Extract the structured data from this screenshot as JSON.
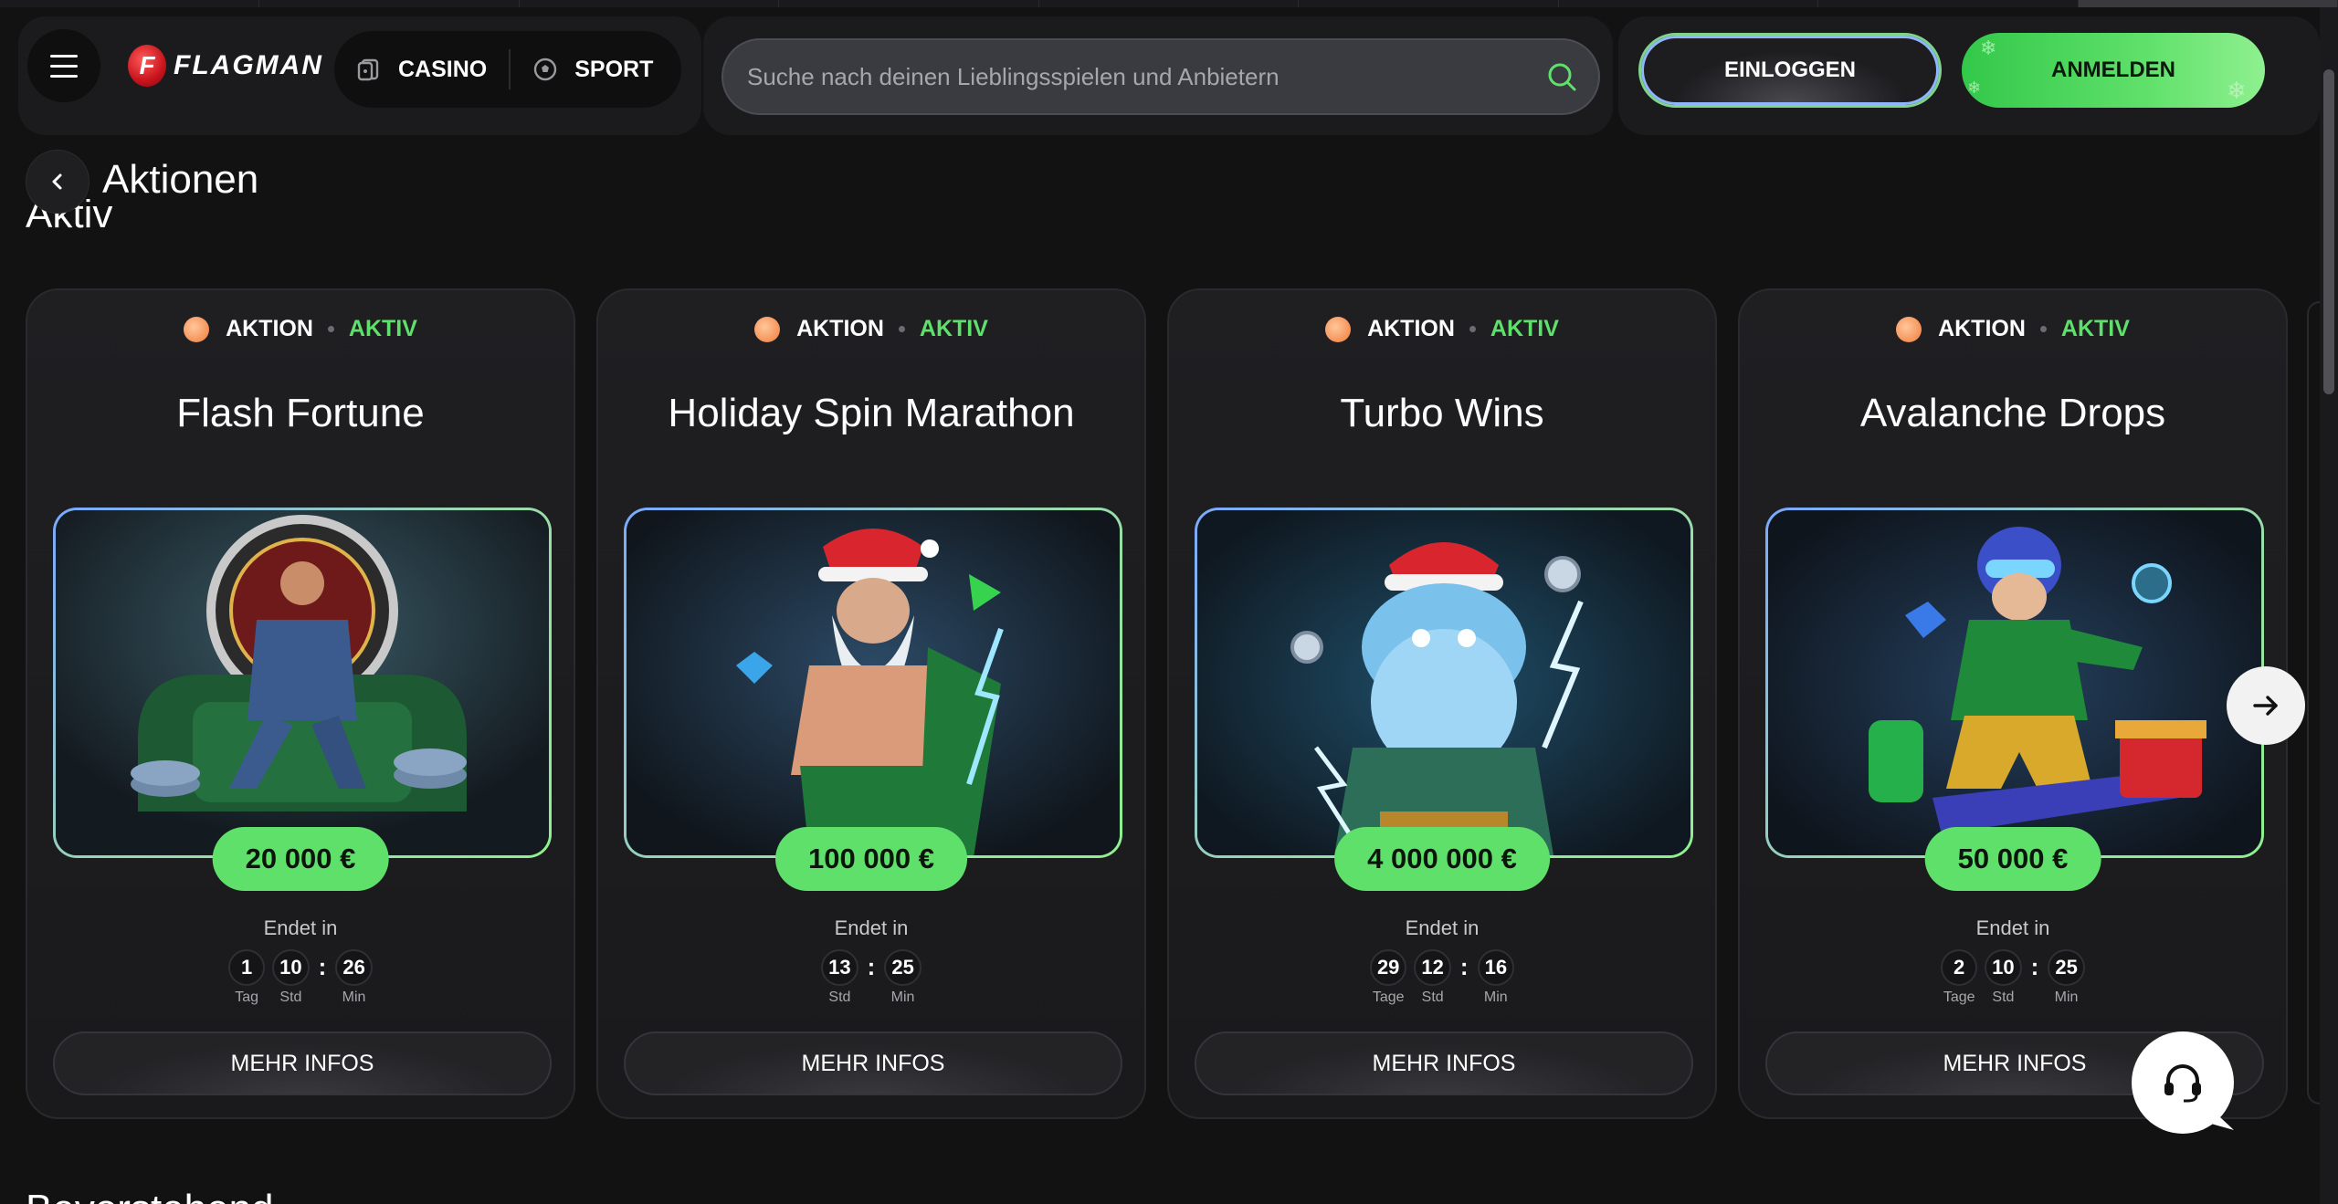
{
  "header": {
    "brand": "FLAGMAN",
    "brand_mark": "F",
    "nav": [
      {
        "label": "CASINO",
        "icon": "casino-icon"
      },
      {
        "label": "SPORT",
        "icon": "soccer-ball-icon"
      }
    ],
    "search_placeholder": "Suche nach deinen Lieblingsspielen und Anbietern",
    "login_label": "EINLOGGEN",
    "register_label": "ANMELDEN"
  },
  "page": {
    "title": "Aktionen",
    "section_title": "Aktiv",
    "next_section_title": "Bevorstehend"
  },
  "colors": {
    "accent_green": "#5ee06b",
    "background": "#121213",
    "card": "#1f1f22"
  },
  "promotions": [
    {
      "type": "AKTION",
      "status": "AKTIV",
      "title": "Flash Fortune",
      "prize": "20 000 €",
      "ends_label": "Endet in",
      "countdown": [
        {
          "value": "1",
          "unit": "Tag"
        },
        {
          "value": "10",
          "unit": "Std"
        },
        {
          "value": "26",
          "unit": "Min"
        }
      ],
      "button": "MEHR INFOS"
    },
    {
      "type": "AKTION",
      "status": "AKTIV",
      "title": "Holiday Spin Marathon",
      "prize": "100 000 €",
      "ends_label": "Endet in",
      "countdown": [
        {
          "value": "13",
          "unit": "Std"
        },
        {
          "value": "25",
          "unit": "Min"
        }
      ],
      "button": "MEHR INFOS"
    },
    {
      "type": "AKTION",
      "status": "AKTIV",
      "title": "Turbo Wins",
      "prize": "4 000 000 €",
      "ends_label": "Endet in",
      "countdown": [
        {
          "value": "29",
          "unit": "Tage"
        },
        {
          "value": "12",
          "unit": "Std"
        },
        {
          "value": "16",
          "unit": "Min"
        }
      ],
      "button": "MEHR INFOS"
    },
    {
      "type": "AKTION",
      "status": "AKTIV",
      "title": "Avalanche Drops",
      "prize": "50 000 €",
      "ends_label": "Endet in",
      "countdown": [
        {
          "value": "2",
          "unit": "Tage"
        },
        {
          "value": "10",
          "unit": "Std"
        },
        {
          "value": "25",
          "unit": "Min"
        }
      ],
      "button": "MEHR INFOS"
    }
  ]
}
